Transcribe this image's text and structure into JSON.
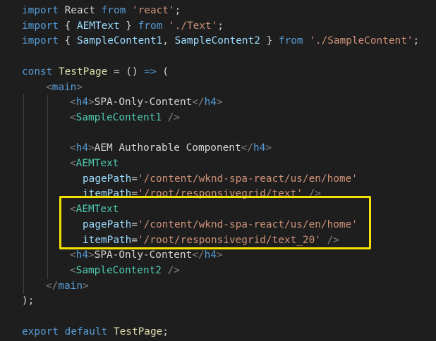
{
  "editor": {
    "language": "javascript-react",
    "theme": "dark",
    "highlight_color": "#f5e100",
    "lines": [
      {
        "tokens": [
          [
            "kw",
            "import"
          ],
          [
            "text",
            " React "
          ],
          [
            "kw",
            "from"
          ],
          [
            "text",
            " "
          ],
          [
            "str",
            "'react'"
          ],
          [
            "text",
            ";"
          ]
        ]
      },
      {
        "tokens": [
          [
            "kw",
            "import"
          ],
          [
            "text",
            " { "
          ],
          [
            "var",
            "AEMText"
          ],
          [
            "text",
            " } "
          ],
          [
            "kw",
            "from"
          ],
          [
            "text",
            " "
          ],
          [
            "str",
            "'./Text'"
          ],
          [
            "text",
            ";"
          ]
        ]
      },
      {
        "tokens": [
          [
            "kw",
            "import"
          ],
          [
            "text",
            " { "
          ],
          [
            "var",
            "SampleContent1"
          ],
          [
            "text",
            ", "
          ],
          [
            "var",
            "SampleContent2"
          ],
          [
            "text",
            " } "
          ],
          [
            "kw",
            "from"
          ],
          [
            "text",
            " "
          ],
          [
            "str",
            "'./SampleContent'"
          ],
          [
            "text",
            ";"
          ]
        ]
      },
      {
        "tokens": []
      },
      {
        "tokens": [
          [
            "kw",
            "const"
          ],
          [
            "text",
            " "
          ],
          [
            "fn",
            "TestPage"
          ],
          [
            "text",
            " = () "
          ],
          [
            "kw",
            "=>"
          ],
          [
            "text",
            " ("
          ]
        ]
      },
      {
        "indent": 1,
        "tokens": [
          [
            "brack",
            "<"
          ],
          [
            "tag",
            "main"
          ],
          [
            "brack",
            ">"
          ]
        ]
      },
      {
        "indent": 2,
        "tokens": [
          [
            "brack",
            "<"
          ],
          [
            "tag",
            "h4"
          ],
          [
            "brack",
            ">"
          ],
          [
            "text",
            "SPA-Only-Content"
          ],
          [
            "brack",
            "</"
          ],
          [
            "tag",
            "h4"
          ],
          [
            "brack",
            ">"
          ]
        ]
      },
      {
        "indent": 2,
        "tokens": [
          [
            "brack",
            "<"
          ],
          [
            "comp",
            "SampleContent1"
          ],
          [
            "text",
            " "
          ],
          [
            "brack",
            "/>"
          ]
        ]
      },
      {
        "tokens": []
      },
      {
        "indent": 2,
        "tokens": [
          [
            "brack",
            "<"
          ],
          [
            "tag",
            "h4"
          ],
          [
            "brack",
            ">"
          ],
          [
            "text",
            "AEM Authorable Component"
          ],
          [
            "brack",
            "</"
          ],
          [
            "tag",
            "h4"
          ],
          [
            "brack",
            ">"
          ]
        ]
      },
      {
        "indent": 2,
        "tokens": [
          [
            "brack",
            "<"
          ],
          [
            "comp",
            "AEMText"
          ]
        ]
      },
      {
        "indent": 2,
        "extra": 18,
        "tokens": [
          [
            "attr",
            "pagePath"
          ],
          [
            "text",
            "="
          ],
          [
            "str",
            "'/content/wknd-spa-react/us/en/home'"
          ]
        ]
      },
      {
        "indent": 2,
        "extra": 18,
        "tokens": [
          [
            "attr",
            "itemPath"
          ],
          [
            "text",
            "="
          ],
          [
            "str",
            "'/root/responsivegrid/text'"
          ],
          [
            "text",
            " "
          ],
          [
            "brack",
            "/>"
          ]
        ]
      },
      {
        "indent": 2,
        "tokens": [
          [
            "brack",
            "<"
          ],
          [
            "comp",
            "AEMText"
          ]
        ]
      },
      {
        "indent": 2,
        "extra": 18,
        "tokens": [
          [
            "attr",
            "pagePath"
          ],
          [
            "text",
            "="
          ],
          [
            "str",
            "'/content/wknd-spa-react/us/en/home'"
          ]
        ]
      },
      {
        "indent": 2,
        "extra": 18,
        "tokens": [
          [
            "attr",
            "itemPath"
          ],
          [
            "text",
            "="
          ],
          [
            "str",
            "'/root/responsivegrid/text_20'"
          ],
          [
            "text",
            " "
          ],
          [
            "brack",
            "/>"
          ]
        ]
      },
      {
        "indent": 2,
        "tokens": [
          [
            "brack",
            "<"
          ],
          [
            "tag",
            "h4"
          ],
          [
            "brack",
            ">"
          ],
          [
            "text",
            "SPA-Only-Content"
          ],
          [
            "brack",
            "</"
          ],
          [
            "tag",
            "h4"
          ],
          [
            "brack",
            ">"
          ]
        ]
      },
      {
        "indent": 2,
        "tokens": [
          [
            "brack",
            "<"
          ],
          [
            "comp",
            "SampleContent2"
          ],
          [
            "text",
            " "
          ],
          [
            "brack",
            "/>"
          ]
        ]
      },
      {
        "indent": 1,
        "tokens": [
          [
            "brack",
            "</"
          ],
          [
            "tag",
            "main"
          ],
          [
            "brack",
            ">"
          ]
        ]
      },
      {
        "tokens": [
          [
            "text",
            ");"
          ]
        ]
      },
      {
        "tokens": []
      },
      {
        "tokens": [
          [
            "kw",
            "export"
          ],
          [
            "text",
            " "
          ],
          [
            "kw",
            "default"
          ],
          [
            "text",
            " "
          ],
          [
            "fn",
            "TestPage"
          ],
          [
            "text",
            ";"
          ]
        ]
      }
    ]
  }
}
